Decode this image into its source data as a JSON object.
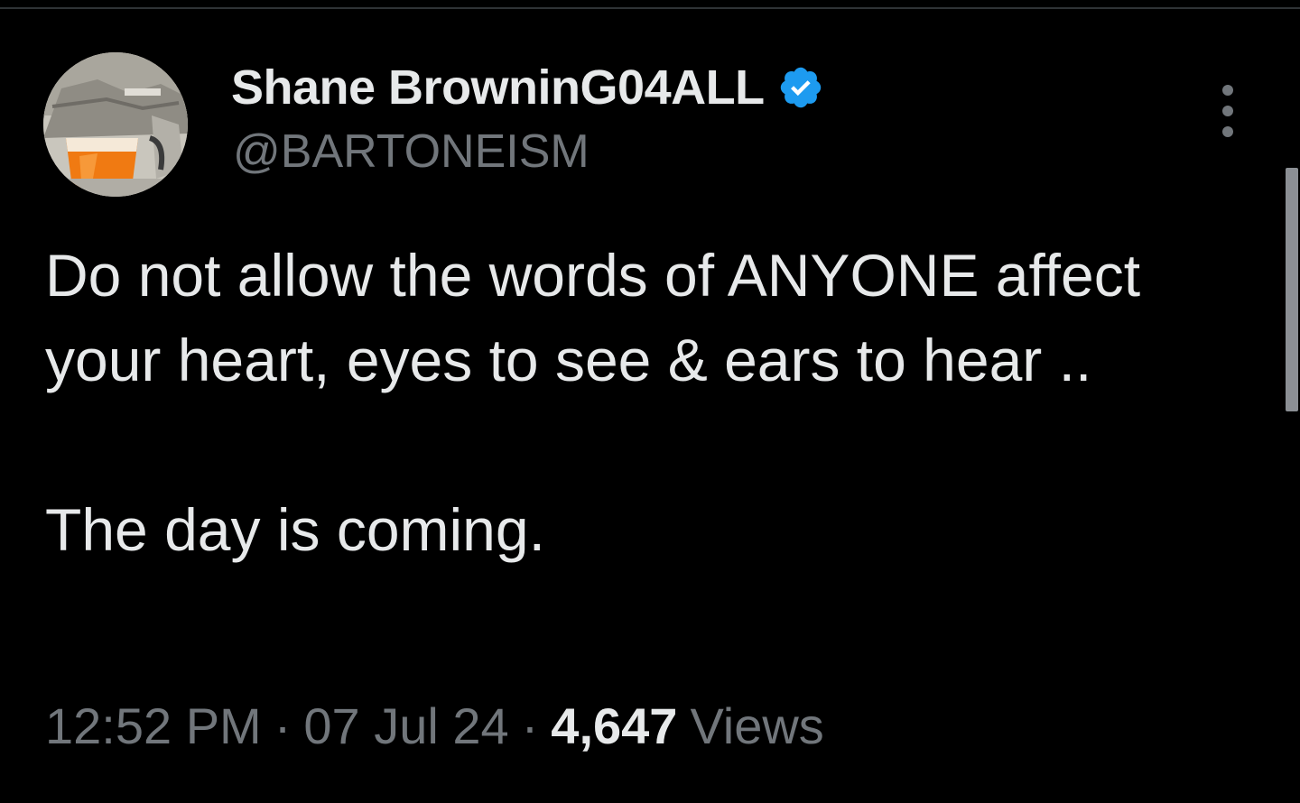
{
  "author": {
    "display_name": "Shane BrowninG04ALL",
    "handle": "@BARTONEISM",
    "verified": true,
    "verified_color": "#1d9bf0",
    "avatar_icon": "avatar-photo"
  },
  "tweet": {
    "paragraphs": [
      "Do not allow the words of ANYONE affect your heart, eyes to see & ears to hear ..",
      "The day is coming."
    ]
  },
  "meta": {
    "time": "12:52 PM",
    "separator": "·",
    "date": "07 Jul 24",
    "views_count": "4,647",
    "views_label": "Views"
  },
  "colors": {
    "background": "#000000",
    "primary_text": "#e7e9ea",
    "secondary_text": "#71767b",
    "accent": "#1d9bf0"
  },
  "icons": {
    "more": "more-vertical-icon",
    "verified": "verified-badge-icon"
  }
}
